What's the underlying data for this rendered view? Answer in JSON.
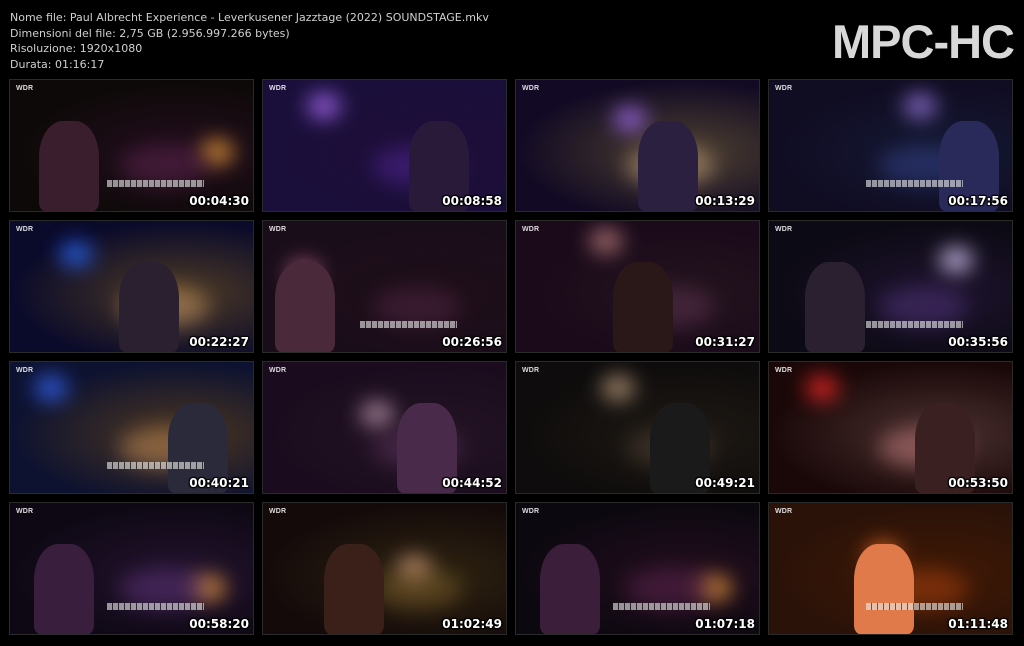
{
  "info": {
    "filename": "Nome file: Paul Albrecht Experience - Leverkusener Jazztage (2022) SOUNDSTAGE.mkv",
    "filesize": "Dimensioni del file: 2,75 GB (2.956.997.266 bytes)",
    "resolution": "Risoluzione: 1920x1080",
    "duration": "Durata: 01:16:17"
  },
  "logo": "MPC-HC",
  "watermark": "WDR",
  "thumbnails": [
    {
      "time": "00:04:30",
      "bg": "#0d0908",
      "g1": "#f2a23a",
      "g2": "#6a2a5a",
      "fig": "#3a1e2e",
      "keys": true
    },
    {
      "time": "00:08:58",
      "bg": "#1a0f3a",
      "g1": "#b070ff",
      "g2": "#5b2aa8",
      "fig": "#2a1a3a",
      "keys": false
    },
    {
      "time": "00:13:29",
      "bg": "#120a24",
      "g1": "#a26cf0",
      "g2": "#e8c090",
      "fig": "#2b2040",
      "keys": false
    },
    {
      "time": "00:17:56",
      "bg": "#100c22",
      "g1": "#9a7ae0",
      "g2": "#3b4a9a",
      "fig": "#2a2a5a",
      "keys": true
    },
    {
      "time": "00:22:27",
      "bg": "#0a0a2a",
      "g1": "#2a6aff",
      "g2": "#e8b070",
      "fig": "#2a2030",
      "keys": false
    },
    {
      "time": "00:26:56",
      "bg": "#1a0d1a",
      "g1": "#c06a90",
      "g2": "#5a2a4a",
      "fig": "#4a2a3a",
      "keys": true
    },
    {
      "time": "00:31:27",
      "bg": "#1a0a1a",
      "g1": "#c08080",
      "g2": "#6a3a5a",
      "fig": "#2a1818",
      "keys": false
    },
    {
      "time": "00:35:56",
      "bg": "#0c0a14",
      "g1": "#e0d0ff",
      "g2": "#5a3a8a",
      "fig": "#2a2030",
      "keys": true
    },
    {
      "time": "00:40:21",
      "bg": "#0d1230",
      "g1": "#3a6aff",
      "g2": "#e0a060",
      "fig": "#2a2a3a",
      "keys": true
    },
    {
      "time": "00:44:52",
      "bg": "#1a0c1e",
      "g1": "#c09ab0",
      "g2": "#6a3a6a",
      "fig": "#4a2a4a",
      "keys": false
    },
    {
      "time": "00:49:21",
      "bg": "#0e0c0c",
      "g1": "#c0a080",
      "g2": "#5a4a3a",
      "fig": "#1a1a1a",
      "keys": false
    },
    {
      "time": "00:53:50",
      "bg": "#1a0808",
      "g1": "#ff2a2a",
      "g2": "#e09090",
      "fig": "#3a2020",
      "keys": false
    },
    {
      "time": "00:58:20",
      "bg": "#0e0814",
      "g1": "#f2a23a",
      "g2": "#6a3a8a",
      "fig": "#3a1e3e",
      "keys": true
    },
    {
      "time": "01:02:49",
      "bg": "#140a0a",
      "g1": "#d09a80",
      "g2": "#8a6a30",
      "fig": "#3a2018",
      "keys": false
    },
    {
      "time": "01:07:18",
      "bg": "#0c0810",
      "g1": "#f2a23a",
      "g2": "#6a2a5a",
      "fig": "#3a1e3a",
      "keys": true
    },
    {
      "time": "01:11:48",
      "bg": "#2a1208",
      "g1": "#ff7a2a",
      "g2": "#c04a10",
      "fig": "#e07a4a",
      "keys": true
    }
  ]
}
